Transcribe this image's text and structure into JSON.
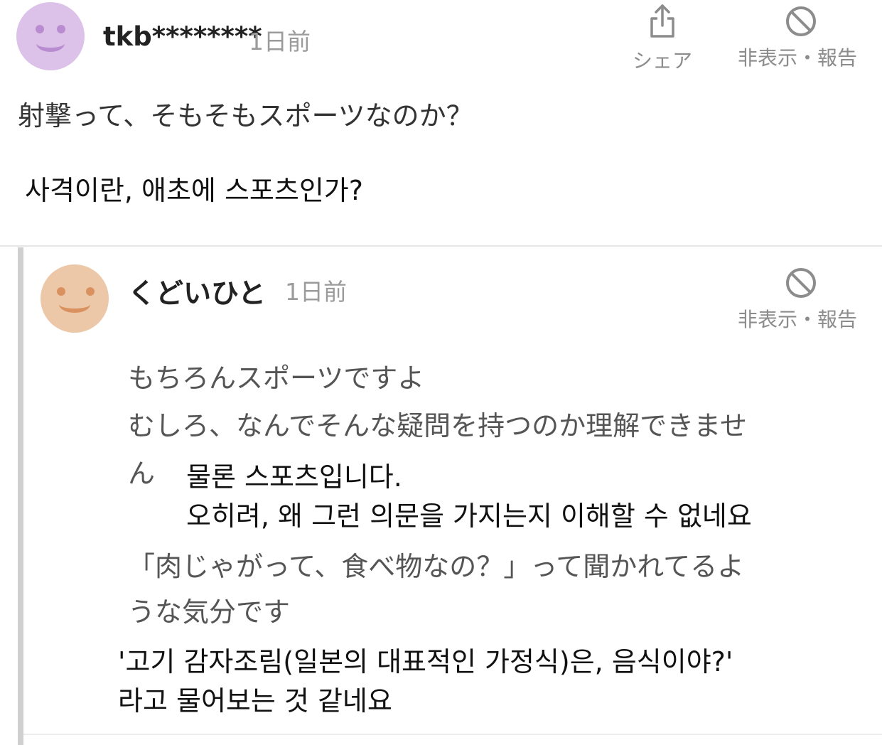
{
  "comment": {
    "user": "tkb********",
    "time": "1日前",
    "actions": {
      "share_label": "シェア",
      "hide_report_label": "非表示・報告"
    },
    "text_ja": "射撃って、そもそもスポーツなのか？",
    "text_ko": "사격이란, 애초에 스포츠인가?"
  },
  "reply": {
    "user": "くどいひと",
    "time": "1日前",
    "actions": {
      "hide_report_label": "非表示・報告"
    },
    "line1_ja": "もちろんスポーツですよ",
    "line2_ja": "むしろ、なんでそんな疑問を持つのか理解できませ",
    "line2b_ja": "ん",
    "ko1_a": "물론 스포츠입니다.",
    "ko1_b": "오히려, 왜 그런 의문을 가지는지 이해할 수 없네요",
    "line3_ja": "「肉じゃがって、食べ物なの？」って聞かれてるよ",
    "line3b_ja": "うな気分です",
    "ko2_a": "'고기 감자조림(일본의 대표적인 가정식)은, 음식이야?'",
    "ko2_b": "라고 물어보는 것 같네요"
  },
  "icons": [
    "smiley-avatar-icon",
    "share-icon",
    "hide-icon"
  ],
  "colors": {
    "avatar1": "#dcc2e8",
    "avatar2": "#ecc7a8",
    "muted": "#9b9b9b"
  }
}
